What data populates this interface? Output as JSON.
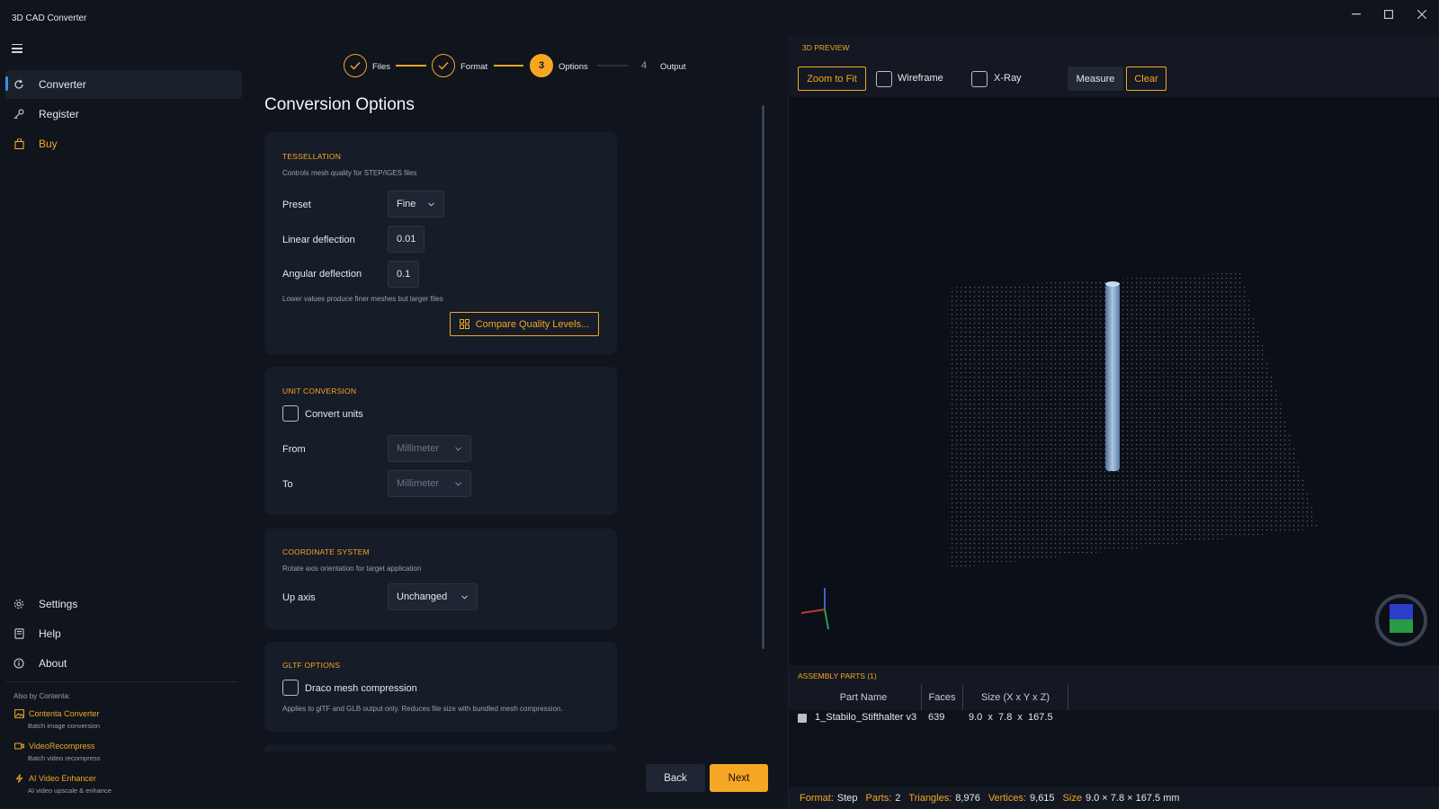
{
  "app": {
    "title": "3D CAD Converter"
  },
  "window": {
    "minimize_icon": "minimize-icon",
    "maximize_icon": "maximize-icon",
    "close_icon": "close-icon"
  },
  "sidebar": {
    "items": [
      {
        "label": "Converter",
        "icon": "refresh-icon",
        "active": true
      },
      {
        "label": "Register",
        "icon": "key-icon"
      },
      {
        "label": "Buy",
        "icon": "shopping-bag-icon"
      }
    ],
    "bottom_items": [
      {
        "label": "Settings",
        "icon": "gear-icon"
      },
      {
        "label": "Help",
        "icon": "book-icon"
      },
      {
        "label": "About",
        "icon": "info-icon"
      }
    ],
    "also_by": "Also by Contenta:",
    "promos": [
      {
        "title": "Contenta Converter",
        "subtitle": "Batch image conversion"
      },
      {
        "title": "VideoRecompress",
        "subtitle": "Batch video recompress"
      },
      {
        "title": "AI Video Enhancer",
        "subtitle": "AI video upscale & enhance"
      }
    ]
  },
  "stepper": {
    "steps": [
      {
        "label": "Files",
        "state": "done"
      },
      {
        "label": "Format",
        "state": "done"
      },
      {
        "number": "3",
        "label": "Options",
        "state": "current"
      },
      {
        "number": "4",
        "label": "Output",
        "state": "pending"
      }
    ]
  },
  "page": {
    "title": "Conversion Options"
  },
  "tessellation": {
    "title": "TESSELLATION",
    "hint": "Controls mesh quality for STEP/IGES files",
    "preset_label": "Preset",
    "preset_value": "Fine",
    "linear_label": "Linear deflection",
    "linear_value": "0.01",
    "angular_label": "Angular deflection",
    "angular_value": "0.1",
    "footnote": "Lower values produce finer meshes but larger files",
    "compare_button": "Compare Quality Levels..."
  },
  "units": {
    "title": "UNIT CONVERSION",
    "convert_label": "Convert units",
    "from_label": "From",
    "from_value": "Millimeter",
    "to_label": "To",
    "to_value": "Millimeter"
  },
  "coords": {
    "title": "COORDINATE SYSTEM",
    "hint": "Rotate axis orientation for target application",
    "up_label": "Up axis",
    "up_value": "Unchanged"
  },
  "gltf": {
    "title": "GLTF OPTIONS",
    "draco_label": "Draco mesh compression",
    "hint": "Applies to glTF and GLB output only. Reduces file size with bundled mesh compression."
  },
  "nav": {
    "back": "Back",
    "next": "Next"
  },
  "preview": {
    "title": "3D PREVIEW",
    "zoom_to_fit": "Zoom to Fit",
    "wireframe": "Wireframe",
    "xray": "X-Ray",
    "measure": "Measure",
    "clear": "Clear"
  },
  "assembly": {
    "title": "ASSEMBLY PARTS",
    "count": "(1)",
    "columns": [
      "Part Name",
      "Faces",
      "Size (X x Y x Z)"
    ],
    "rows": [
      {
        "name": "1_Stabilo_Stifthalter v3",
        "faces": "639",
        "size": "9.0  x  7.8  x  167.5"
      }
    ]
  },
  "status": {
    "format_label": "Format:",
    "format_value": "Step",
    "parts_label": "Parts:",
    "parts_value": "2",
    "triangles_label": "Triangles:",
    "triangles_value": "8,976",
    "vertices_label": "Vertices:",
    "vertices_value": "9,615",
    "size_label": "Size",
    "size_value": "9.0 × 7.8 × 167.5 mm"
  },
  "colors": {
    "accent": "#f5a623",
    "active_indicator": "#3b8ff0",
    "background": "#0f141d",
    "card": "#161c28"
  }
}
